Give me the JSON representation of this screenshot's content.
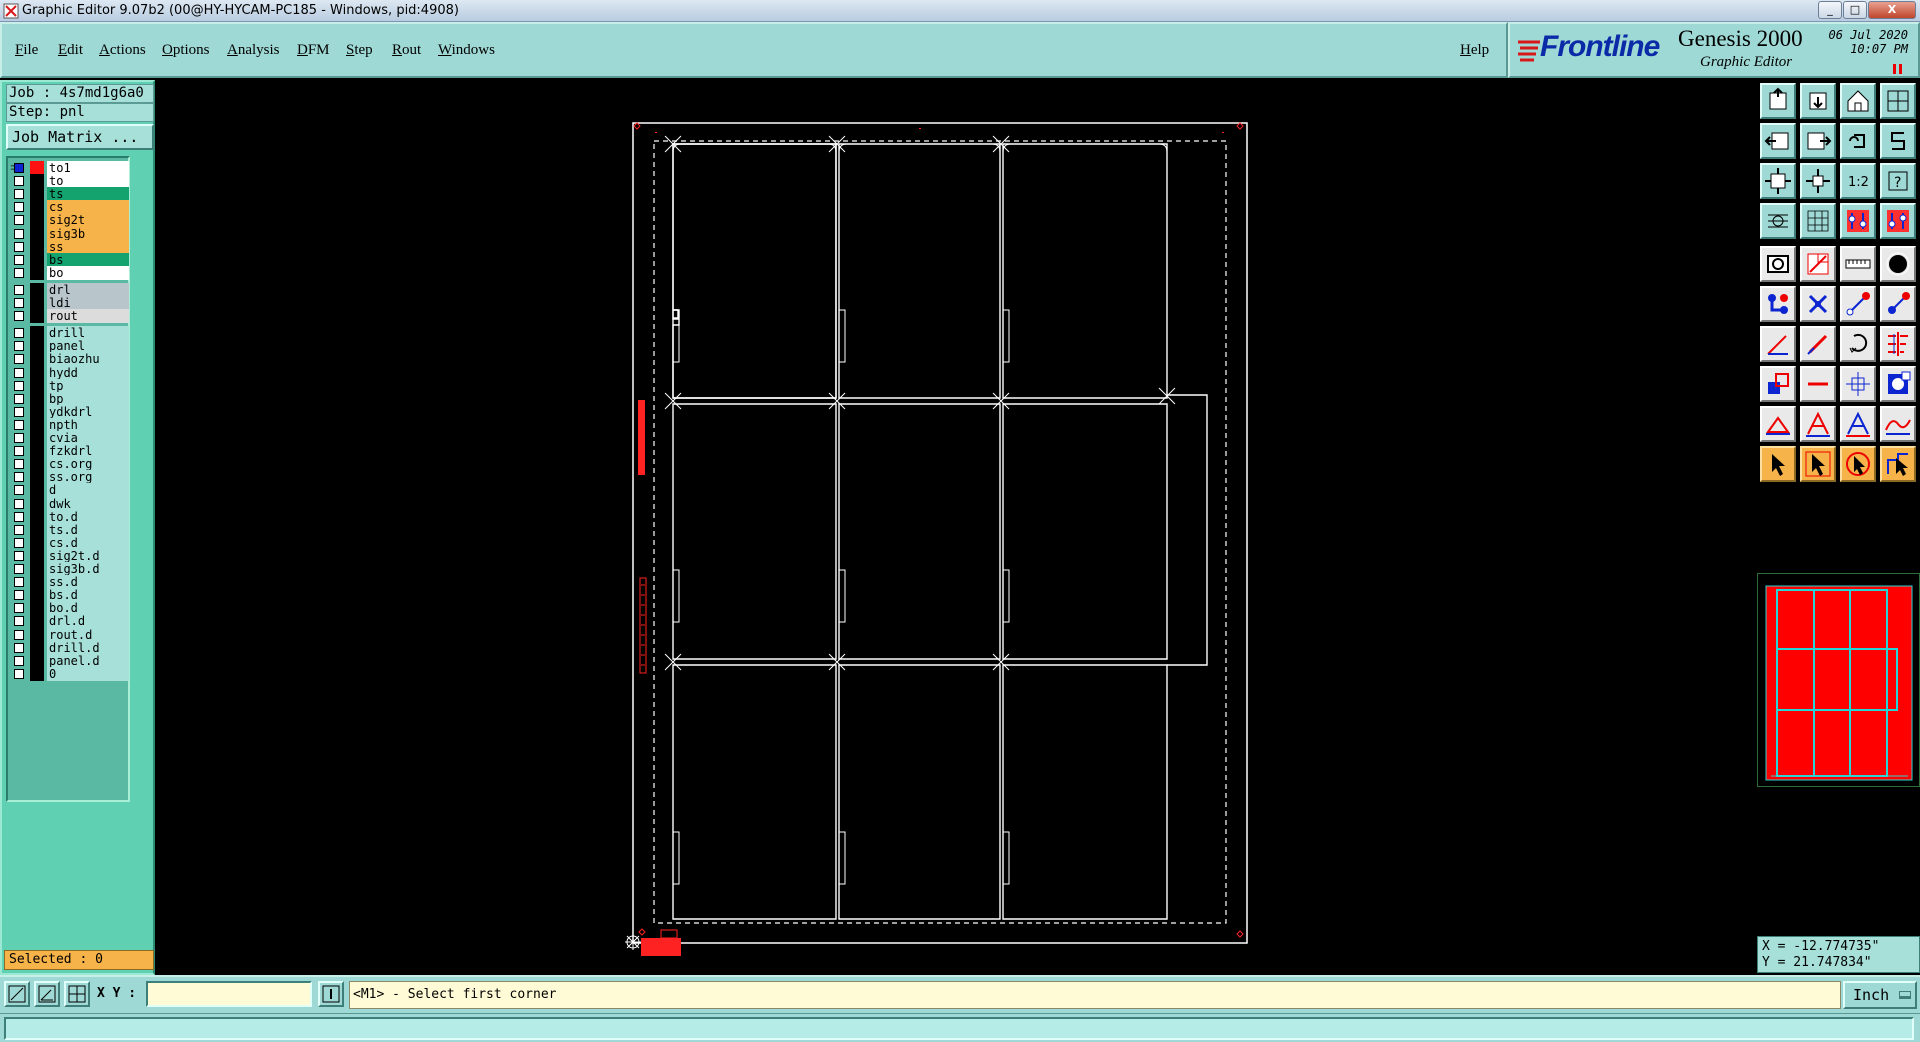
{
  "window": {
    "title": "Graphic Editor 9.07b2 (00@HY-HYCAM-PC185 - Windows, pid:4908)",
    "controls": [
      "_",
      "□",
      "X"
    ]
  },
  "menu": [
    "File",
    "Edit",
    "Actions",
    "Options",
    "Analysis",
    "DFM",
    "Step",
    "Rout",
    "Windows"
  ],
  "help": "Help",
  "brand": {
    "logo": "Frontline",
    "product": "Genesis 2000",
    "subtitle": "Graphic Editor",
    "date": "06 Jul 2020",
    "time": "10:07 PM"
  },
  "job": {
    "job_line": "Job : 4s7md1g6a0",
    "step_line": "Step: pnl",
    "matrix_button": "Job Matrix ...",
    "selected": "Selected : 0"
  },
  "colors": {
    "board_outline": "#ffffff",
    "layer_red": "#ff1111",
    "layer_orange": "#f5b349",
    "layer_teal": "#14a36e",
    "layer_cyan": "#a6e0d9",
    "layer_gray": "#b8c6cc",
    "minimap_fill": "#ff0000",
    "minimap_lines": "#29d4d4"
  },
  "layers": [
    {
      "name": "to1",
      "color": "#ffffff",
      "checked": true,
      "mark": "red",
      "extra": "="
    },
    {
      "name": "to",
      "color": "#ffffff"
    },
    {
      "name": "ts",
      "color": "#14a36e"
    },
    {
      "name": "cs",
      "color": "#f5b349"
    },
    {
      "name": "sig2t",
      "color": "#f5b349"
    },
    {
      "name": "sig3b",
      "color": "#f5b349"
    },
    {
      "name": "ss",
      "color": "#f5b349"
    },
    {
      "name": "bs",
      "color": "#14a36e"
    },
    {
      "name": "bo",
      "color": "#ffffff"
    },
    {
      "name": "drl",
      "color": "#b8c6cc",
      "gap": true
    },
    {
      "name": "ldi",
      "color": "#b8c6cc"
    },
    {
      "name": "rout",
      "color": "#dcdcdc"
    },
    {
      "name": "drill",
      "color": "#a6e0d9",
      "gap": true
    },
    {
      "name": "panel",
      "color": "#a6e0d9"
    },
    {
      "name": "biaozhu",
      "color": "#a6e0d9"
    },
    {
      "name": "hydd",
      "color": "#a6e0d9"
    },
    {
      "name": "tp",
      "color": "#a6e0d9"
    },
    {
      "name": "bp",
      "color": "#a6e0d9"
    },
    {
      "name": "ydkdrl",
      "color": "#a6e0d9"
    },
    {
      "name": "npth",
      "color": "#a6e0d9"
    },
    {
      "name": "cvia",
      "color": "#a6e0d9"
    },
    {
      "name": "fzkdrl",
      "color": "#a6e0d9"
    },
    {
      "name": "cs.org",
      "color": "#a6e0d9"
    },
    {
      "name": "ss.org",
      "color": "#a6e0d9"
    },
    {
      "name": "d",
      "color": "#a6e0d9"
    },
    {
      "name": "dwk",
      "color": "#a6e0d9"
    },
    {
      "name": "to.d",
      "color": "#a6e0d9"
    },
    {
      "name": "ts.d",
      "color": "#a6e0d9"
    },
    {
      "name": "cs.d",
      "color": "#a6e0d9"
    },
    {
      "name": "sig2t.d",
      "color": "#a6e0d9"
    },
    {
      "name": "sig3b.d",
      "color": "#a6e0d9"
    },
    {
      "name": "ss.d",
      "color": "#a6e0d9"
    },
    {
      "name": "bs.d",
      "color": "#a6e0d9"
    },
    {
      "name": "bo.d",
      "color": "#a6e0d9"
    },
    {
      "name": "drl.d",
      "color": "#a6e0d9"
    },
    {
      "name": "rout.d",
      "color": "#a6e0d9"
    },
    {
      "name": "drill.d",
      "color": "#a6e0d9"
    },
    {
      "name": "panel.d",
      "color": "#a6e0d9"
    },
    {
      "name": "0",
      "color": "#a6e0d9"
    }
  ],
  "toolbox": [
    [
      "zoom-home-icon",
      "zoom-in-icon",
      "home-icon",
      "split-view-icon"
    ],
    [
      "pan-left-icon",
      "pan-right-icon",
      "undo-zoom-icon",
      "redo-zoom-icon"
    ],
    [
      "fit-icon",
      "fit-step-icon",
      "ratio-icon",
      "help-icon"
    ],
    [
      "snap-icon",
      "grid-icon",
      "layer-red-icon",
      "layer-blue-icon"
    ],
    [
      "measure-icon",
      "delete-icon",
      "ruler-icon",
      "pad-icon"
    ],
    [
      "connect-icon",
      "cross-icon",
      "line-icon",
      "node-icon"
    ],
    [
      "slope-icon",
      "draw-line-icon",
      "rotate-icon",
      "align-icon"
    ],
    [
      "transform-icon",
      "minus-icon",
      "dimension-icon",
      "move-icon"
    ],
    [
      "triangle-icon",
      "arc-icon",
      "arch-icon",
      "wave-icon"
    ],
    [
      "select-icon",
      "select-net-icon",
      "select-area-icon",
      "select-poly-icon"
    ]
  ],
  "coords": {
    "x": "X = -12.774735\"",
    "y": "Y = 21.747834\""
  },
  "status": {
    "xy_label": "X Y :",
    "xy_value": "",
    "prompt": "<M1> - Select first corner",
    "units": "Inch",
    "command": ""
  }
}
